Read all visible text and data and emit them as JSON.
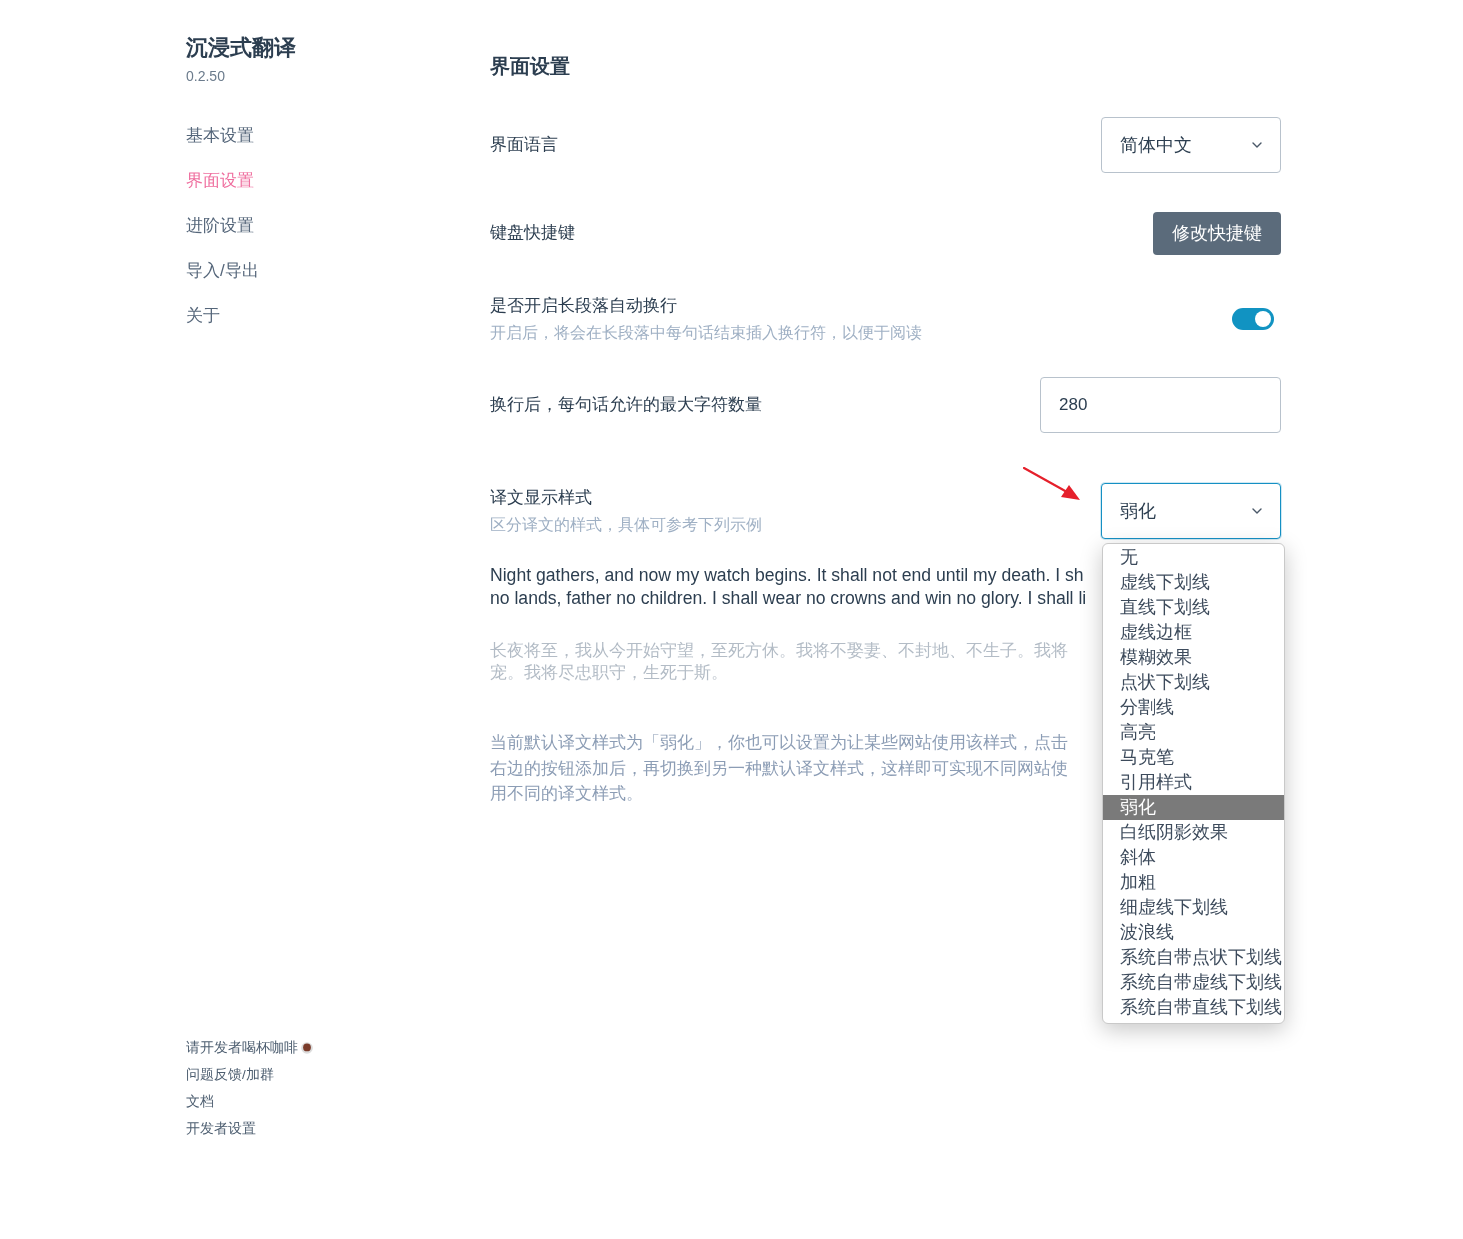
{
  "sidebar": {
    "title": "沉浸式翻译",
    "version": "0.2.50",
    "nav": [
      {
        "label": "基本设置",
        "selected": false
      },
      {
        "label": "界面设置",
        "selected": true
      },
      {
        "label": "进阶设置",
        "selected": false
      },
      {
        "label": "导入/导出",
        "selected": false
      },
      {
        "label": "关于",
        "selected": false
      }
    ],
    "footer_links": [
      {
        "label": "请开发者喝杯咖啡",
        "kind": "donate"
      },
      {
        "label": "问题反馈/加群",
        "kind": "link"
      },
      {
        "label": "文档",
        "kind": "link"
      },
      {
        "label": "开发者设置",
        "kind": "link"
      }
    ]
  },
  "main": {
    "title": "界面设置",
    "settings": [
      {
        "kind": "select",
        "label": "界面语言",
        "value": "简体中文",
        "expanded": false
      },
      {
        "kind": "button",
        "label": "键盘快捷键",
        "button": "修改快捷键"
      },
      {
        "kind": "toggle",
        "label": "是否开启长段落自动换行",
        "description": "开启后，将会在长段落中每句话结束插入换行符，以便于阅读",
        "on": true
      },
      {
        "kind": "input",
        "label": "换行后，每句话允许的最大字符数量",
        "value": "280"
      },
      {
        "kind": "select",
        "label": "译文显示样式",
        "description": "区分译文的样式，具体可参考下列示例",
        "value": "弱化",
        "expanded": true,
        "options": [
          {
            "label": "无",
            "selected": false
          },
          {
            "label": "虚线下划线",
            "selected": false
          },
          {
            "label": "直线下划线",
            "selected": false
          },
          {
            "label": "虚线边框",
            "selected": false
          },
          {
            "label": "模糊效果",
            "selected": false
          },
          {
            "label": "点状下划线",
            "selected": false
          },
          {
            "label": "分割线",
            "selected": false
          },
          {
            "label": "高亮",
            "selected": false
          },
          {
            "label": "马克笔",
            "selected": false
          },
          {
            "label": "引用样式",
            "selected": false
          },
          {
            "label": "弱化",
            "selected": true
          },
          {
            "label": "白纸阴影效果",
            "selected": false
          },
          {
            "label": "斜体",
            "selected": false
          },
          {
            "label": "加粗",
            "selected": false
          },
          {
            "label": "细虚线下划线",
            "selected": false
          },
          {
            "label": "波浪线",
            "selected": false
          },
          {
            "label": "系统自带点状下划线",
            "selected": false
          },
          {
            "label": "系统自带虚线下划线",
            "selected": false
          },
          {
            "label": "系统自带直线下划线",
            "selected": false
          }
        ]
      }
    ],
    "sample": {
      "original_lines": [
        "Night gathers, and now my watch begins. It shall not end until my death. I sh",
        "no lands, father no children. I shall wear no crowns and win no glory. I shall li"
      ],
      "translation_lines": [
        "长夜将至，我从今开始守望，至死方休。我将不娶妻、不封地、不生子。我将",
        "宠。我将尽忠职守，生死于斯。"
      ]
    },
    "note": "当前默认译文样式为「弱化」，你也可以设置为让某些网站使用该样式，点击右边的按钮添加后，再切换到另一种默认译文样式，这样即可实现不同网站使用不同的译文样式。"
  }
}
